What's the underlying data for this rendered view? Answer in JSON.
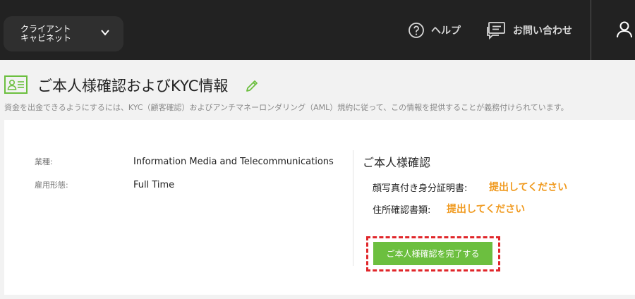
{
  "topbar": {
    "cabinet_label": "クライアント\nキャビネット",
    "help_label": "ヘルプ",
    "contact_label": "お問い合わせ"
  },
  "page": {
    "title": "ご本人様確認およびKYC情報",
    "description": "資金を出金できるようにするには、KYC（顧客確認）およびアンチマネーロンダリング（AML）規約に従って、この情報を提供することが義務付けられています。"
  },
  "profile": {
    "fields": [
      {
        "label": "業種:",
        "value": "Information Media and Telecommunications"
      },
      {
        "label": "雇用形態:",
        "value": "Full Time"
      }
    ]
  },
  "kyc": {
    "title": "ご本人様確認",
    "documents": [
      {
        "label": "顔写真付き身分証明書:",
        "status": "提出してください"
      },
      {
        "label": "住所確認書類:",
        "status": "提出してください"
      }
    ],
    "complete_button": "ご本人様確認を完了する"
  },
  "colors": {
    "topbar_bg": "#222222",
    "accent_green": "#6cbf3f",
    "status_orange": "#f09a1f",
    "highlight_red": "#e0262a"
  },
  "icons": [
    "chevron-down-icon",
    "help-circle-icon",
    "chat-icon",
    "user-icon",
    "id-card-icon",
    "pencil-icon"
  ]
}
